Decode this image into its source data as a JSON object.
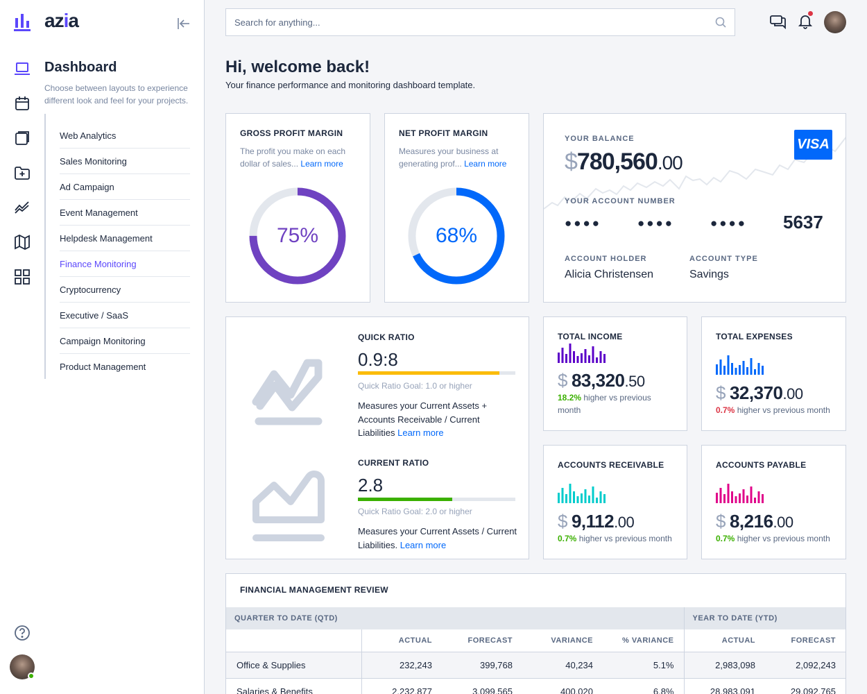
{
  "app": {
    "logo_prefix": "az",
    "logo_i": "i",
    "logo_suffix": "a"
  },
  "nav": {
    "title": "Dashboard",
    "description": "Choose between layouts to experience different look and feel for your projects.",
    "items": [
      {
        "label": "Web Analytics"
      },
      {
        "label": "Sales Monitoring"
      },
      {
        "label": "Ad Campaign"
      },
      {
        "label": "Event Management"
      },
      {
        "label": "Helpdesk Management"
      },
      {
        "label": "Finance Monitoring",
        "active": true
      },
      {
        "label": "Cryptocurrency"
      },
      {
        "label": "Executive / SaaS"
      },
      {
        "label": "Campaign Monitoring"
      },
      {
        "label": "Product Management"
      }
    ]
  },
  "search": {
    "placeholder": "Search for anything..."
  },
  "page": {
    "title": "Hi, welcome back!",
    "subtitle": "Your finance performance and monitoring dashboard template."
  },
  "gross": {
    "title": "Gross Profit Margin",
    "desc": "The profit you make on each dollar of sales...",
    "link": "Learn more",
    "value": "75%",
    "pct": 75,
    "color": "#6f42c1"
  },
  "net": {
    "title": "Net Profit Margin",
    "desc": "Measures your business at generating prof...",
    "link": "Learn more",
    "value": "68%",
    "pct": 68,
    "color": "#0168fa"
  },
  "balance": {
    "label": "Your Balance",
    "currency": "$",
    "amount": "780,560",
    "decimals": ".00",
    "card_brand": "VISA",
    "account_label": "Your Account Number",
    "account_mask": "●●●●",
    "account_last": "5637",
    "holder_label": "Account Holder",
    "holder": "Alicia Christensen",
    "type_label": "Account Type",
    "type": "Savings"
  },
  "quick": {
    "title": "Quick Ratio",
    "value": "0.9:8",
    "fill": 0.9,
    "color": "#fbbc0b",
    "goal": "Quick Ratio Goal: 1.0 or higher",
    "desc": "Measures your Current Assets + Accounts Receivable / Current Liabilities",
    "link": "Learn more"
  },
  "current": {
    "title": "Current Ratio",
    "value": "2.8",
    "fill": 0.6,
    "color": "#3bb001",
    "goal": "Quick Ratio Goal: 2.0 or higher",
    "desc": "Measures your Current Assets / Current Liabilities.",
    "link": "Learn more"
  },
  "stats": [
    {
      "title": "Total Income",
      "currency": "$",
      "amount": "83,320",
      "decimals": ".50",
      "pct": "18.2%",
      "trend": "up",
      "text": "higher vs previous month",
      "color": "#5b00c8"
    },
    {
      "title": "Total Expenses",
      "currency": "$",
      "amount": "32,370",
      "decimals": ".00",
      "pct": "0.7%",
      "trend": "down",
      "text": "higher vs previous month",
      "color": "#0168fa"
    },
    {
      "title": "Accounts Receivable",
      "currency": "$",
      "amount": "9,112",
      "decimals": ".00",
      "pct": "0.7%",
      "trend": "up",
      "text": "higher vs previous month",
      "color": "#00cccc"
    },
    {
      "title": "Accounts Payable",
      "currency": "$",
      "amount": "8,216",
      "decimals": ".00",
      "pct": "0.7%",
      "trend": "up",
      "text": "higher vs previous month",
      "color": "#e0048a"
    }
  ],
  "review": {
    "title": "Financial Management Review",
    "qtd_label": "Quarter to Date (QTD)",
    "ytd_label": "Year to Date (YTD)",
    "columns": [
      "Actual",
      "Forecast",
      "Variance",
      "% Variance",
      "Actual",
      "Forecast"
    ],
    "rows": [
      {
        "name": "Office & Supplies",
        "cells": [
          "232,243",
          "399,768",
          "40,234",
          "5.1%",
          "2,983,098",
          "2,092,243"
        ]
      },
      {
        "name": "Salaries & Benefits",
        "cells": [
          "2,232,877",
          "3,099,565",
          "400,020",
          "6.8%",
          "28,983,091",
          "29,092,765"
        ]
      }
    ]
  }
}
